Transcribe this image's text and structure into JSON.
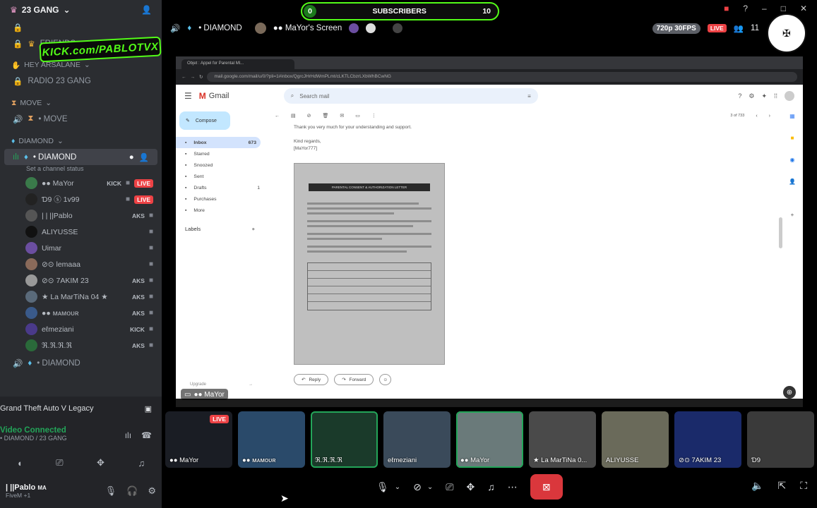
{
  "server": {
    "name": "23 GANG"
  },
  "channels_top": [
    {
      "label": "FRIENDS",
      "icon": "crown-icon"
    }
  ],
  "categories": [
    {
      "label": "HEY ARSALANE",
      "channels": [
        "RADIO 23 GANG"
      ]
    },
    {
      "label": "MOVE",
      "channels": [
        "• MOVE"
      ]
    },
    {
      "label": "DIAMOND"
    }
  ],
  "active_channel": {
    "label": "• DIAMOND",
    "status_placeholder": "Set a channel status"
  },
  "voice_users": [
    {
      "name": "●● MaYor",
      "tag": "KICK",
      "live": "LIVE",
      "color": "#3a7a4a"
    },
    {
      "name": "Ɗ9  ⓢ 1v99",
      "tag": "",
      "live": "LIVE",
      "color": "#222222"
    },
    {
      "name": "| | ||Pablo",
      "tag": "AKS",
      "live": "",
      "color": "#555555"
    },
    {
      "name": "ALIYUSSE",
      "tag": "",
      "live": "",
      "color": "#111111"
    },
    {
      "name": "Uimar",
      "tag": "",
      "live": "",
      "color": "#6b4ea0"
    },
    {
      "name": "⊘⊙ lemaaa",
      "tag": "",
      "live": "",
      "color": "#8a6a5a"
    },
    {
      "name": "⊘⊙ 7AKIM 23",
      "tag": "AKS",
      "live": "",
      "color": "#999999"
    },
    {
      "name": "★ La MarTiNa 04 ★",
      "tag": "AKS",
      "live": "",
      "color": "#5a6a7a"
    },
    {
      "name": "●● ᴍᴀᴍᴏᴜʀ",
      "tag": "AKS",
      "live": "",
      "color": "#3a5a8a"
    },
    {
      "name": "eℓmeziani",
      "tag": "KICK",
      "live": "",
      "color": "#4a3a8a"
    },
    {
      "name": "ℜ.ℜ.ℜ.ℜ",
      "tag": "AKS",
      "live": "",
      "color": "#2a6a3a"
    }
  ],
  "next_channel": "• DIAMOND",
  "kick_overlay": "KICK.com/PABLOTVX",
  "game_activity": "Grand Theft Auto V Legacy",
  "voice_connection": {
    "status": "Video Connected",
    "location": "• DIAMOND / 23 GANG"
  },
  "self_user": {
    "name": "| ||Pablo",
    "tag": "MA",
    "sub": "FiveM +1"
  },
  "topbar": {
    "channel": "• DIAMOND",
    "screen_title": "●● MaYor's Screen",
    "quality": "720p 30FPS",
    "live": "LIVE",
    "participants": "11"
  },
  "sub_counter": {
    "start": "0",
    "label": "SUBSCRIBERS",
    "goal": "10"
  },
  "shared_screen": {
    "tab_title": "Objet : Appel for Parental Ml...",
    "url": "mail.google.com/mail/u/0/?pli=1#inbox/QgrcJHrHdWmPLmt/cLKTLCbzrLXbWhBCwNG",
    "gmail_label": "Gmail",
    "search_placeholder": "Search mail",
    "compose": "Compose",
    "nav": [
      {
        "label": "Inbox",
        "count": "673"
      },
      {
        "label": "Starred",
        "count": ""
      },
      {
        "label": "Snoozed",
        "count": ""
      },
      {
        "label": "Sent",
        "count": ""
      },
      {
        "label": "Drafts",
        "count": "1"
      },
      {
        "label": "Purchases",
        "count": ""
      },
      {
        "label": "More",
        "count": ""
      }
    ],
    "labels_heading": "Labels",
    "pagination": "3 of 733",
    "mail_lines": [
      "Thank you very much for your understanding and support.",
      "Kind regards,",
      "[MaYor777]"
    ],
    "document_title": "PARENTAL CONSENT & AUTHORIZATION LETTER",
    "reply": "Reply",
    "forward": "Forward",
    "upgrade": "Upgrade"
  },
  "screen_label": "●● MaYor",
  "tiles": [
    {
      "name": "●● MaYor",
      "live": "LIVE",
      "bg": "#1a1d24"
    },
    {
      "name": "●● ᴍᴀᴍᴏᴜʀ",
      "live": "",
      "bg": "#2a4a6a"
    },
    {
      "name": "ℜ.ℜ.ℜ.ℜ",
      "live": "",
      "bg": "#1a3a2a"
    },
    {
      "name": "eℓmeziani",
      "live": "",
      "bg": "#3a4a5a"
    },
    {
      "name": "●● MaYor",
      "live": "",
      "bg": "#6a7a7a"
    },
    {
      "name": "★ La MarTiNa 0...",
      "live": "",
      "bg": "#4a4a4a"
    },
    {
      "name": "ALIYUSSE",
      "live": "",
      "bg": "#6a6a5a"
    },
    {
      "name": "⊘⊙ 7AKIM 23",
      "live": "",
      "bg": "#1a2a6a"
    },
    {
      "name": "Ɗ9",
      "live": "",
      "bg": "#3a3a3a"
    }
  ],
  "colors": {
    "sidebar": "#2b2d31",
    "live": "#ed4245",
    "kick_green": "#53fc18",
    "connected": "#23a559",
    "end_call": "#da373c"
  }
}
